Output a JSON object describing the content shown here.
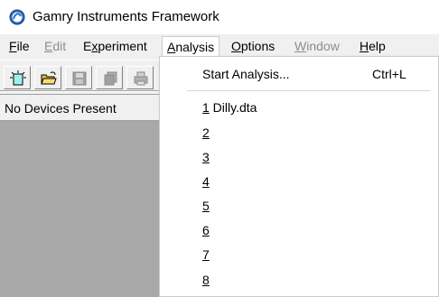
{
  "window": {
    "title": "Gamry Instruments Framework",
    "icon": "gamry-app-icon"
  },
  "menubar": {
    "items": [
      {
        "label": "File",
        "accel": "F",
        "rest": "ile",
        "enabled": true
      },
      {
        "label": "Edit",
        "accel": "E",
        "rest": "dit",
        "enabled": false
      },
      {
        "label": "Experiment",
        "accel": "x",
        "pre": "E",
        "rest": "periment",
        "enabled": true
      },
      {
        "label": "Analysis",
        "accel": "A",
        "rest": "nalysis",
        "enabled": true,
        "open": true
      },
      {
        "label": "Options",
        "accel": "O",
        "rest": "ptions",
        "enabled": true
      },
      {
        "label": "Window",
        "accel": "W",
        "rest": "indow",
        "enabled": false
      },
      {
        "label": "Help",
        "accel": "H",
        "rest": "elp",
        "enabled": true
      }
    ]
  },
  "toolbar": {
    "buttons": [
      {
        "name": "new-icon",
        "enabled": true
      },
      {
        "name": "open-folder-icon",
        "enabled": true
      },
      {
        "name": "save-icon",
        "enabled": false
      },
      {
        "name": "copy-icon",
        "enabled": false
      },
      {
        "name": "print-icon",
        "enabled": false
      }
    ]
  },
  "device_panel": {
    "header": "No Devices Present"
  },
  "analysis_menu": {
    "start_label": "Start Analysis...",
    "start_shortcut": "Ctrl+L",
    "recent_files": [
      {
        "num": "1",
        "name": " Dilly.dta"
      },
      {
        "num": "2",
        "name": ""
      },
      {
        "num": "3",
        "name": ""
      },
      {
        "num": "4",
        "name": ""
      },
      {
        "num": "5",
        "name": ""
      },
      {
        "num": "6",
        "name": ""
      },
      {
        "num": "7",
        "name": ""
      },
      {
        "num": "8",
        "name": ""
      }
    ]
  },
  "colors": {
    "chrome": "#f0f0f0",
    "device_area": "#a9a9a9",
    "menu_bg": "#ffffff",
    "disabled_text": "#8c8c8c"
  }
}
